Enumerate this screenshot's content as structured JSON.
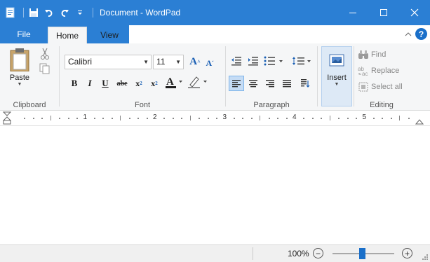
{
  "window": {
    "title": "Document - WordPad"
  },
  "tabs": {
    "file": "File",
    "home": "Home",
    "view": "View",
    "help": "?"
  },
  "clipboard": {
    "paste": "Paste",
    "group_label": "Clipboard"
  },
  "font": {
    "family": "Calibri",
    "size": "11",
    "group_label": "Font"
  },
  "paragraph": {
    "group_label": "Paragraph"
  },
  "insert": {
    "label": "Insert"
  },
  "editing": {
    "find": "Find",
    "replace": "Replace",
    "select_all": "Select all",
    "group_label": "Editing"
  },
  "ruler": {
    "numbers": [
      "1",
      "2",
      "3",
      "4",
      "5"
    ]
  },
  "status": {
    "zoom_percent": "100%",
    "zoom_minus": "−",
    "zoom_plus": "+"
  },
  "colors": {
    "titlebar": "#2b7fd4",
    "accent": "#1a6fc9",
    "ribbon_bg": "#f5f6f7"
  }
}
